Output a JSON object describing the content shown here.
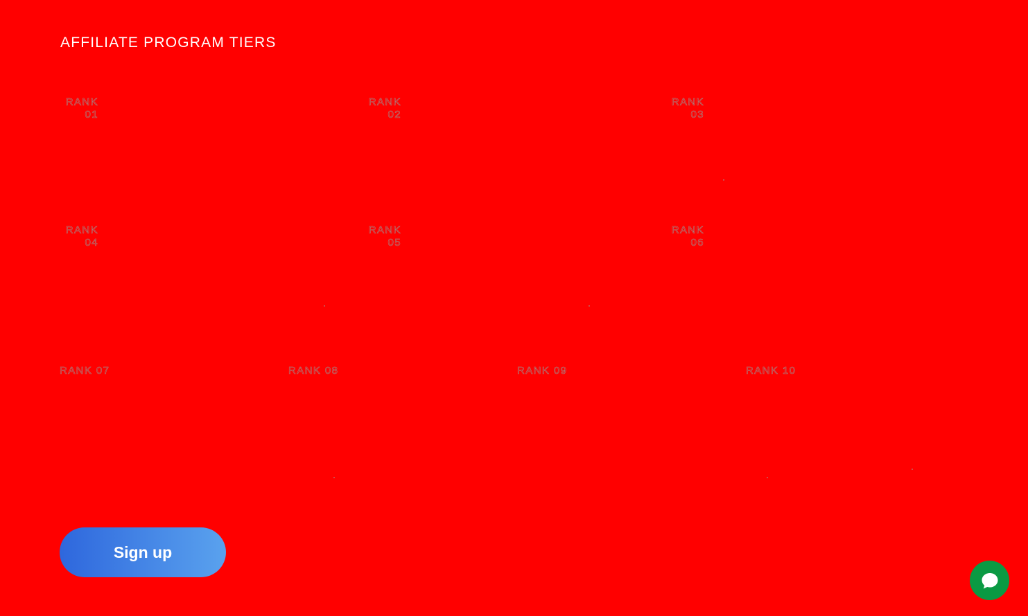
{
  "section": {
    "title": "AFFILIATE PROGRAM TIERS"
  },
  "ranks": [
    {
      "word": "RANK",
      "number": "01"
    },
    {
      "word": "RANK",
      "number": "02"
    },
    {
      "word": "RANK",
      "number": "03"
    },
    {
      "word": "RANK",
      "number": "04"
    },
    {
      "word": "RANK",
      "number": "05"
    },
    {
      "word": "RANK",
      "number": "06"
    },
    {
      "label": "RANK 07"
    },
    {
      "label": "RANK 08"
    },
    {
      "label": "RANK 09"
    },
    {
      "label": "RANK 10"
    }
  ],
  "cta": {
    "signup_label": "Sign up"
  },
  "chat": {
    "icon": "chat-bubble-icon"
  },
  "colors": {
    "background": "#ff0000",
    "button_gradient_start": "#2e67dd",
    "button_gradient_end": "#5aa2ee",
    "chat_button": "#0a9a43"
  }
}
